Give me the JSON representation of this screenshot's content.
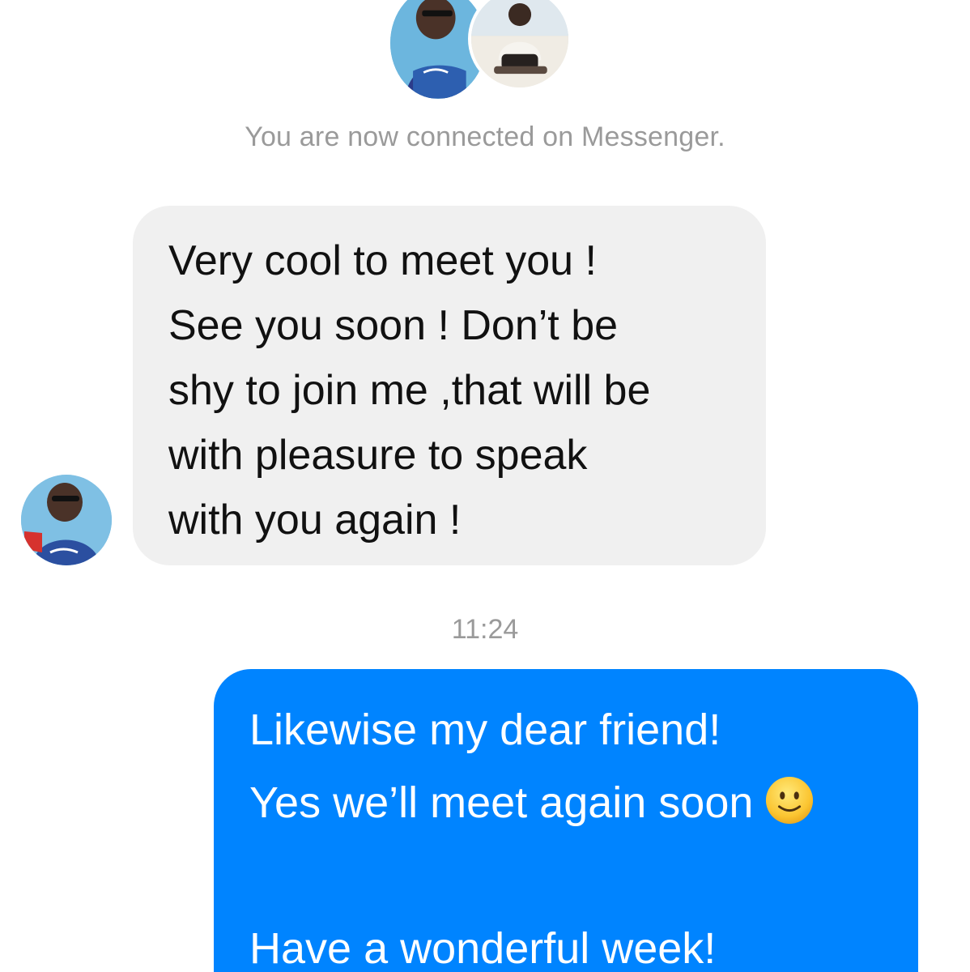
{
  "header": {
    "avatars": [
      {
        "icon": "contact-avatar-icon"
      },
      {
        "icon": "user-avatar-icon"
      }
    ],
    "connected_notice": "You are now connected on Messenger."
  },
  "conversation": {
    "incoming": {
      "lines": [
        "Very cool to meet you !",
        "See you soon ! Don’t be",
        "shy to join me ,that will be",
        "with pleasure to speak",
        "with you again !"
      ],
      "bubble_color": "#f0f0f0",
      "text_color": "#111111"
    },
    "timestamp": "11:24",
    "outgoing": {
      "lines": [
        "Likewise my dear friend!",
        "Yes we’ll meet again soon",
        "",
        "Have a wonderful week!"
      ],
      "emoji": "slightly-smiling-face-icon",
      "bubble_color": "#0084ff",
      "text_color": "#ffffff"
    }
  }
}
